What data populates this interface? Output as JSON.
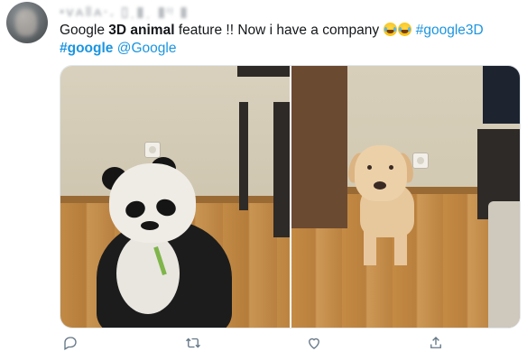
{
  "author": {
    "display_name": "•ᴠᴀ‖ᴀ·.  ▯ˌ▮ˌ ▮ᶦᵎ ▮"
  },
  "tweet": {
    "text_1": "Google ",
    "bold": "3D animal",
    "text_2": " feature !! Now i have a company ",
    "hashtag_1": "#google3D",
    "hashtag_2": "#google",
    "mention": "@Google"
  },
  "media": {
    "left_photo": "panda",
    "right_photo": "dog"
  },
  "actions": [
    {
      "icon": "reply-icon"
    },
    {
      "icon": "retweet-icon"
    },
    {
      "icon": "like-icon"
    },
    {
      "icon": "share-icon"
    }
  ],
  "colors": {
    "link": "#1b95e0",
    "icon": "#657786",
    "text": "#14171a"
  }
}
